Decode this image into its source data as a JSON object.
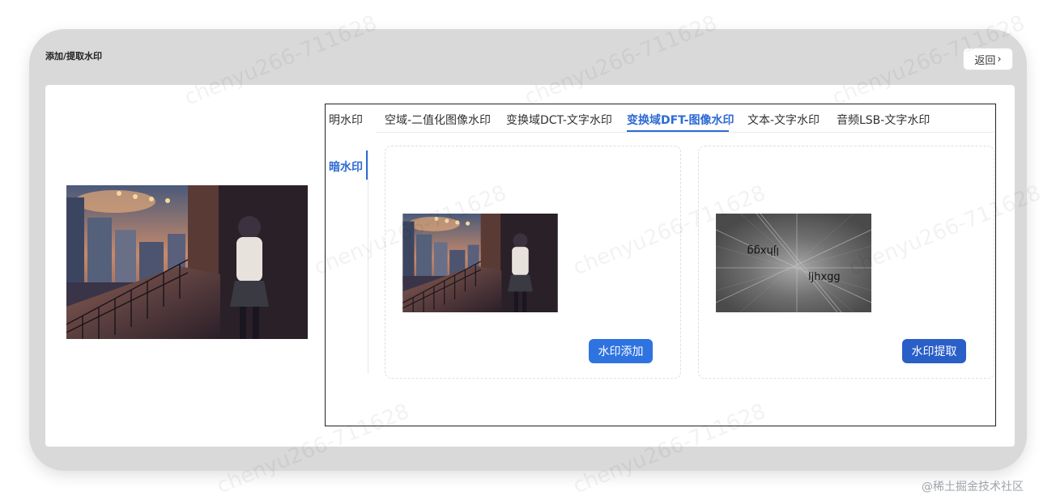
{
  "page": {
    "title": "添加/提取水印",
    "back_label": "返回",
    "back_icon": "chevron-right-icon"
  },
  "modes": [
    {
      "label": "明水印",
      "active": false
    },
    {
      "label": "暗水印",
      "active": true
    }
  ],
  "tabs": [
    {
      "label": "空域-二值化图像水印",
      "active": false
    },
    {
      "label": "变换域DCT-文字水印",
      "active": false
    },
    {
      "label": "变换域DFT-图像水印",
      "active": true
    },
    {
      "label": "文本-文字水印",
      "active": false
    },
    {
      "label": "音频LSB-文字水印",
      "active": false
    }
  ],
  "panels": {
    "add": {
      "button_label": "水印添加"
    },
    "extract": {
      "button_label": "水印提取",
      "spectrum_text_main": "ljhxgg",
      "spectrum_text_mirror": "ljhxgg"
    }
  },
  "watermark_text": "chenyu266-711628",
  "site_credit": "@稀土掘金技术社区",
  "colors": {
    "accent": "#2e6bd4",
    "button": "#2f73e0",
    "frame": "#d9d9d9"
  }
}
